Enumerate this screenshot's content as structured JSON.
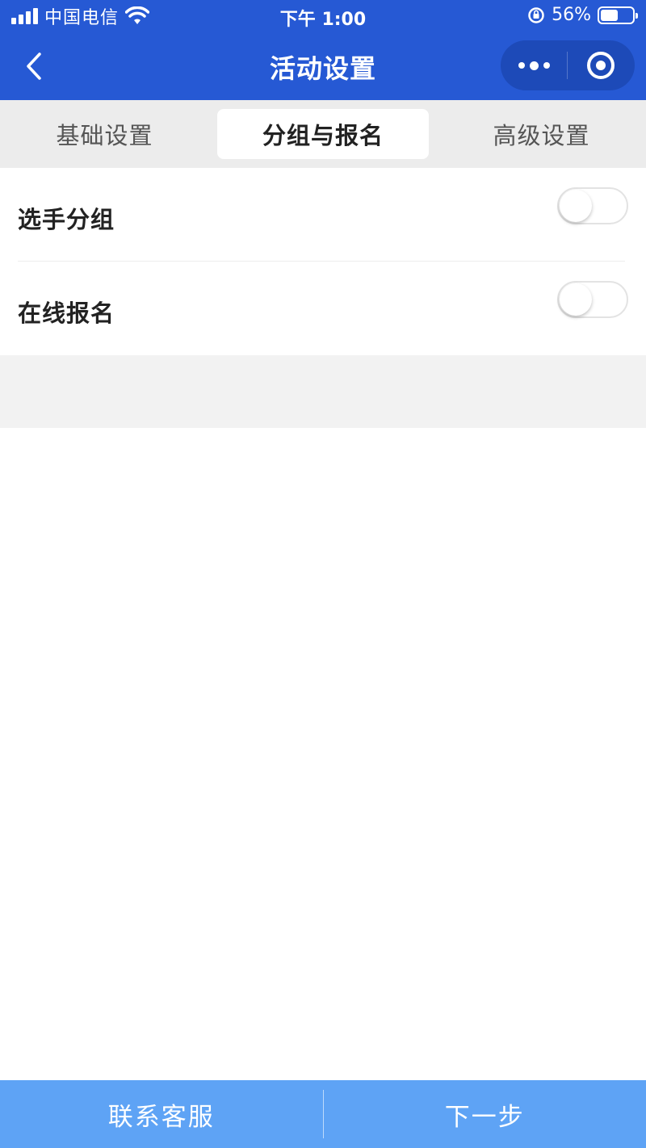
{
  "status_bar": {
    "carrier": "中国电信",
    "time": "下午 1:00",
    "battery_percent": "56%",
    "battery_level": 0.56,
    "icons": [
      "signal-icon",
      "wifi-icon",
      "rotation-lock-icon",
      "battery-icon"
    ]
  },
  "nav": {
    "title": "活动设置",
    "icons": [
      "back-icon",
      "more-icon",
      "close-mini-program-icon"
    ]
  },
  "tabs": [
    {
      "label": "基础设置",
      "active": false
    },
    {
      "label": "分组与报名",
      "active": true
    },
    {
      "label": "高级设置",
      "active": false
    }
  ],
  "settings": [
    {
      "label": "选手分组",
      "enabled": false
    },
    {
      "label": "在线报名",
      "enabled": false
    }
  ],
  "bottom_bar": {
    "contact_label": "联系客服",
    "next_label": "下一步"
  },
  "colors": {
    "header": "#2659d4",
    "capsule": "#1d4ab8",
    "bottom_bar": "#5ea3f5",
    "tab_bg": "#ececec"
  }
}
